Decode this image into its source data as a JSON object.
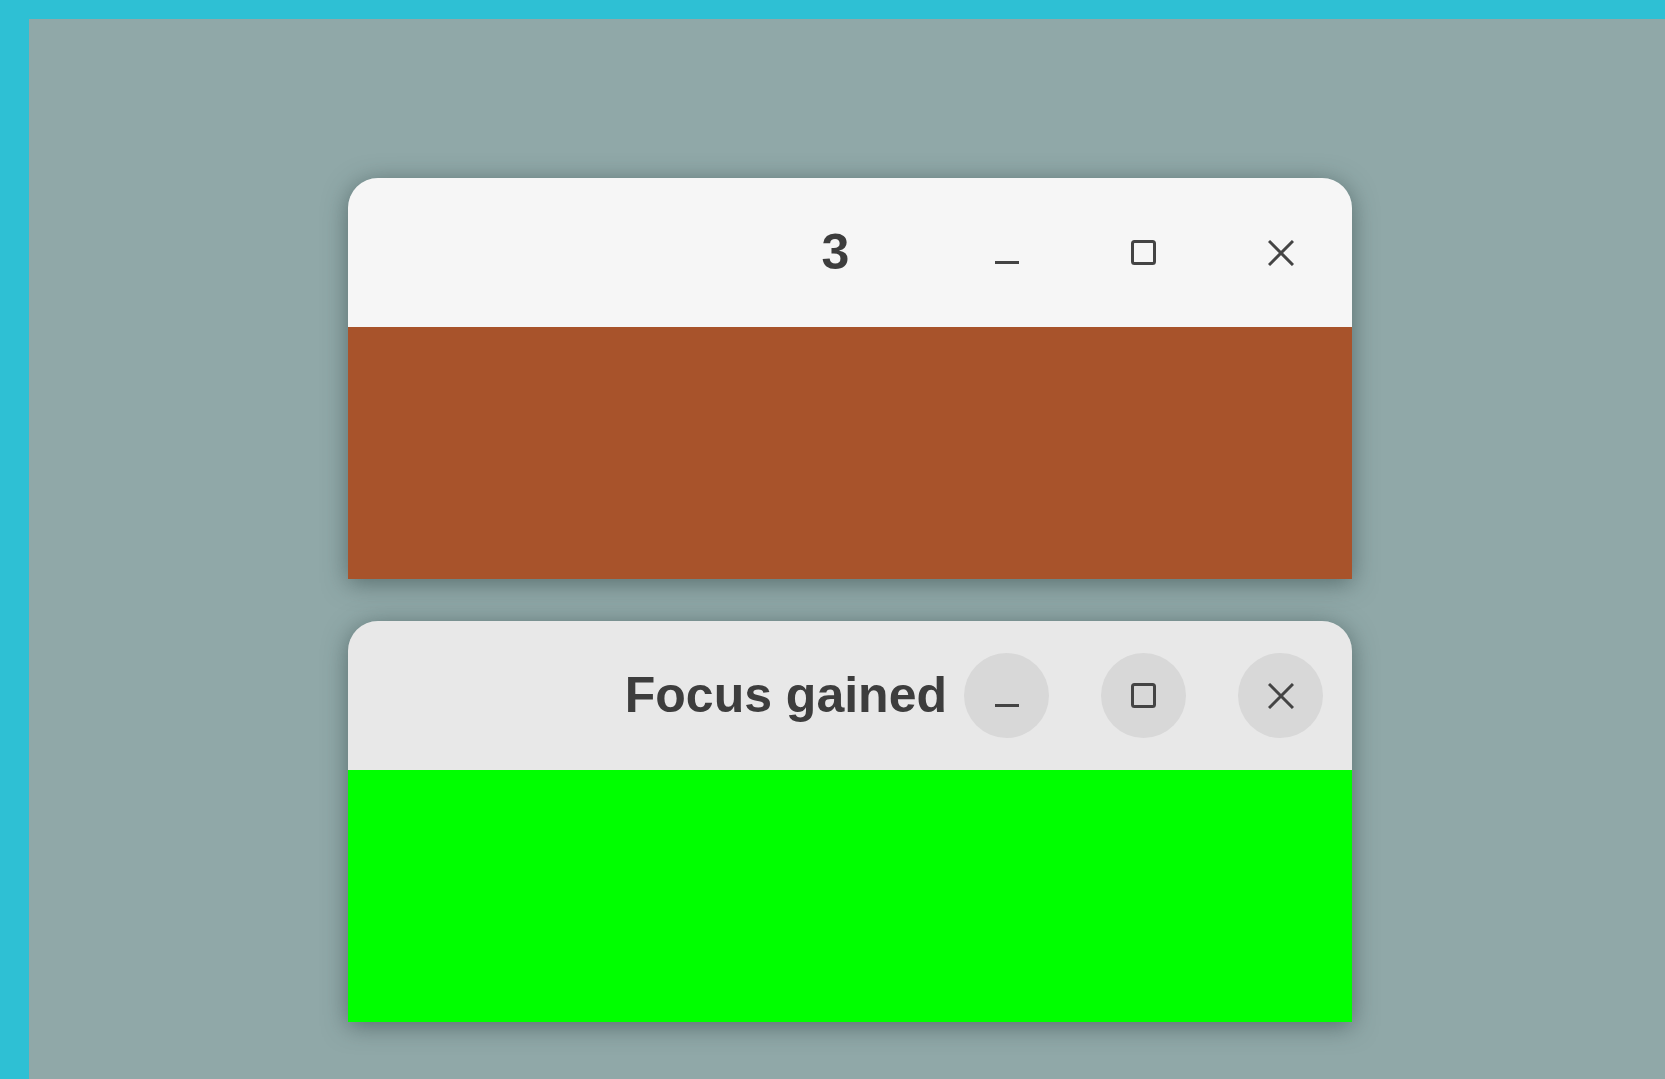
{
  "windows": [
    {
      "title": "3",
      "focused": false,
      "color": "#a8532b"
    },
    {
      "title": "Focus gained",
      "focused": true,
      "color": "#00ff00"
    }
  ]
}
